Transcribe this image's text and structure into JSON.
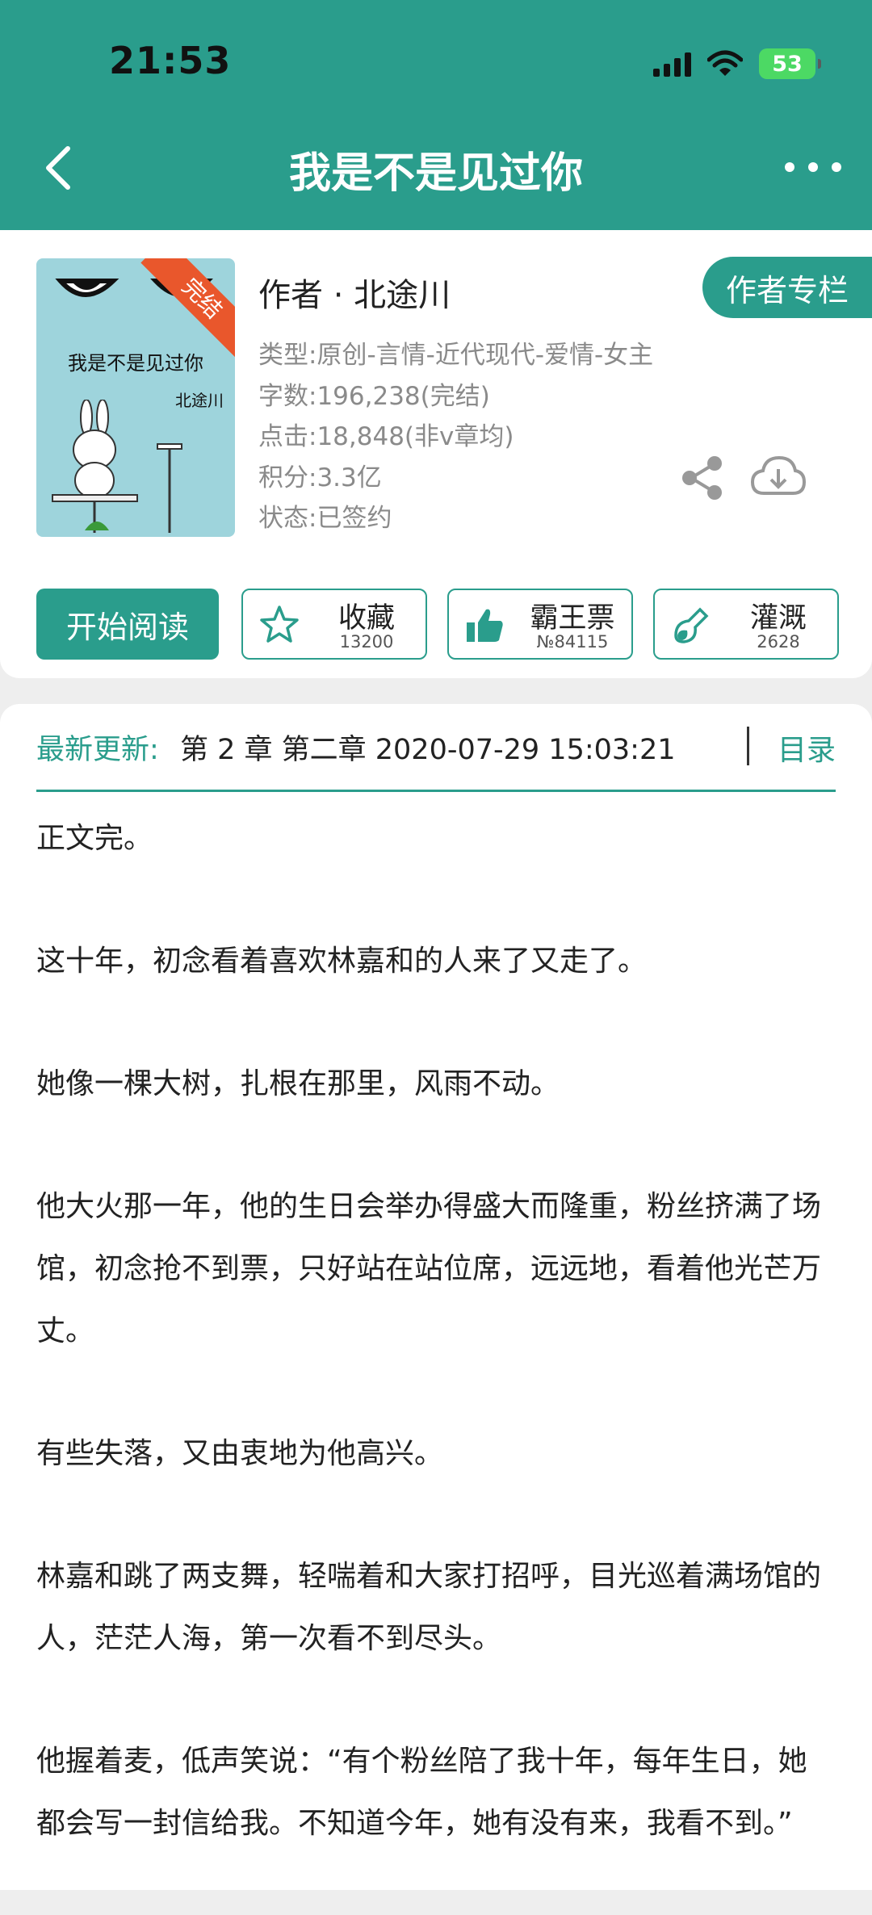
{
  "status_bar": {
    "time": "21:53",
    "battery": "53"
  },
  "nav": {
    "title": "我是不是见过你"
  },
  "book": {
    "cover_title": "我是不是见过你",
    "cover_author": "北途川",
    "cover_badge": "完结",
    "author_line": "作者 · 北途川",
    "author_column_label": "作者专栏",
    "meta": [
      "类型:原创-言情-近代现代-爱情-女主",
      "字数:196,238(完结)",
      "点击:18,848(非v章均)",
      "积分:3.3亿",
      "状态:已签约"
    ]
  },
  "actions": {
    "read_label": "开始阅读",
    "favorite": {
      "label": "收藏",
      "count": "13200"
    },
    "vote": {
      "label": "霸王票",
      "count": "№84115"
    },
    "nutrient": {
      "label": "灌溉",
      "count": "2628"
    }
  },
  "update": {
    "label": "最新更新:",
    "text": "第 2 章 第二章 2020-07-29 15:03:21",
    "toc_label": "目录"
  },
  "paragraphs": [
    "正文完。",
    "这十年，初念看着喜欢林嘉和的人来了又走了。",
    "她像一棵大树，扎根在那里，风雨不动。",
    "他大火那一年，他的生日会举办得盛大而隆重，粉丝挤满了场馆，初念抢不到票，只好站在站位席，远远地，看着他光芒万丈。",
    "有些失落，又由衷地为他高兴。",
    "林嘉和跳了两支舞，轻喘着和大家打招呼，目光巡着满场馆的人，茫茫人海，第一次看不到尽头。",
    "他握着麦，低声笑说：“有个粉丝陪了我十年，每年生日，她都会写一封信给我。不知道今年，她有没有来，我看不到。”"
  ],
  "colors": {
    "accent": "#2a9d8c",
    "ribbon": "#e9572c",
    "cover_bg": "#9ed4dc"
  }
}
